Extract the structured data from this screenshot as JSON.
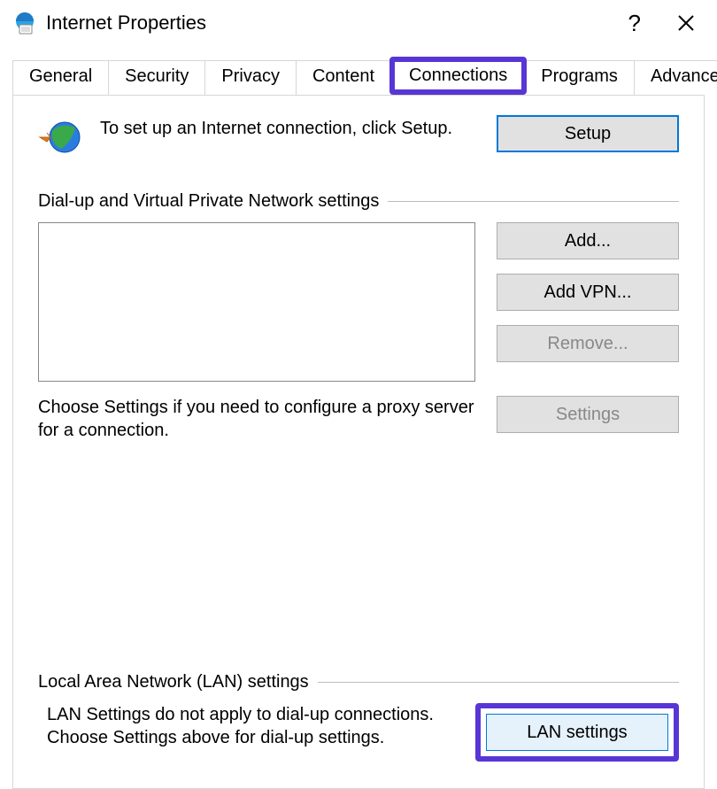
{
  "window": {
    "title": "Internet Properties",
    "help": "?",
    "close": "✕"
  },
  "tabs": {
    "items": [
      {
        "label": "General"
      },
      {
        "label": "Security"
      },
      {
        "label": "Privacy"
      },
      {
        "label": "Content"
      },
      {
        "label": "Connections",
        "active": true
      },
      {
        "label": "Programs"
      },
      {
        "label": "Advanced"
      }
    ]
  },
  "panel": {
    "intro_text": "To set up an Internet connection, click Setup.",
    "setup_button": "Setup",
    "dialup_heading": "Dial-up and Virtual Private Network settings",
    "buttons": {
      "add": "Add...",
      "add_vpn": "Add VPN...",
      "remove": "Remove...",
      "settings": "Settings"
    },
    "choose_text": "Choose Settings if you need to configure a proxy server for a connection.",
    "lan_heading": "Local Area Network (LAN) settings",
    "lan_text": "LAN Settings do not apply to dial-up connections. Choose Settings above for dial-up settings.",
    "lan_button": "LAN settings"
  }
}
